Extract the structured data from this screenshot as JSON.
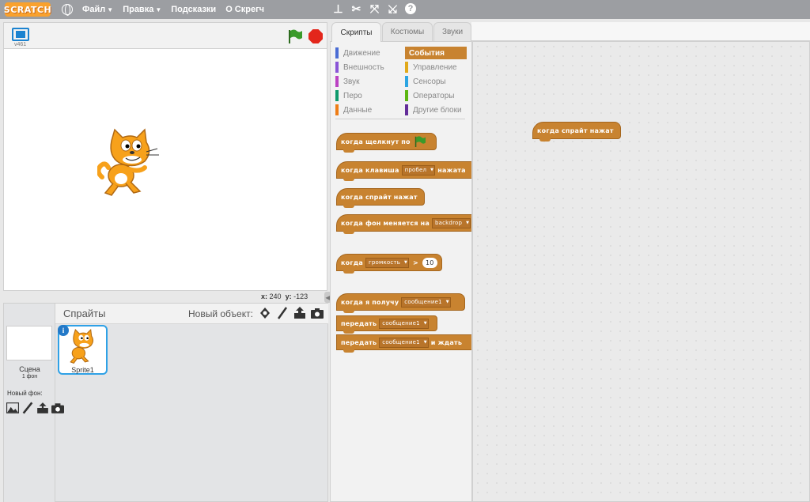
{
  "app": {
    "logo_text": "SCRATCH",
    "version": "v461"
  },
  "menu": {
    "items": [
      {
        "label": "Файл",
        "dropdown": true
      },
      {
        "label": "Правка",
        "dropdown": true
      },
      {
        "label": "Подсказки",
        "dropdown": false
      },
      {
        "label": "О Скрегч",
        "dropdown": false
      }
    ]
  },
  "stage": {
    "coords": {
      "x_label": "x:",
      "x_value": "240",
      "y_label": "y:",
      "y_value": "-123"
    }
  },
  "sprites": {
    "title": "Спрайты",
    "new_object_label": "Новый объект:",
    "stage_label": "Сцена",
    "stage_sub": "1 фон",
    "new_backdrop_label": "Новый фон:",
    "sprite_name": "Sprite1",
    "info_glyph": "i"
  },
  "tabs": [
    {
      "label": "Скрипты",
      "active": true
    },
    {
      "label": "Костюмы",
      "active": false
    },
    {
      "label": "Звуки",
      "active": false
    }
  ],
  "categories": {
    "left": [
      {
        "label": "Движение",
        "color": "#4a6cd4"
      },
      {
        "label": "Внешность",
        "color": "#8a55d7"
      },
      {
        "label": "Звук",
        "color": "#bb42c3"
      },
      {
        "label": "Перо",
        "color": "#0e9a6c"
      },
      {
        "label": "Данные",
        "color": "#ee7d16"
      }
    ],
    "right": [
      {
        "label": "События",
        "color": "#c88330",
        "selected": true
      },
      {
        "label": "Управление",
        "color": "#e1a91a"
      },
      {
        "label": "Сенсоры",
        "color": "#2ca5e2"
      },
      {
        "label": "Операторы",
        "color": "#5cb712"
      },
      {
        "label": "Другие блоки",
        "color": "#632d99"
      }
    ]
  },
  "palette_blocks": {
    "when_flag": {
      "text": "когда щелкнут по"
    },
    "when_key": {
      "text_before": "когда клавиша",
      "dropdown": "пробел",
      "text_after": "нажата"
    },
    "when_sprite_clicked": {
      "text": "когда спрайт нажат"
    },
    "when_backdrop": {
      "text": "когда фон меняется на",
      "dropdown": "backdrop"
    },
    "when_loudness": {
      "text": "когда",
      "dropdown": "громкость",
      "op": ">",
      "value": "10"
    },
    "when_receive": {
      "text": "когда я получу",
      "dropdown": "сообщение1"
    },
    "broadcast": {
      "text": "передать",
      "dropdown": "сообщение1"
    },
    "broadcast_wait": {
      "text": "передать",
      "dropdown": "сообщение1",
      "text_after": "и ждать"
    }
  },
  "script_blocks": {
    "when_sprite_clicked": {
      "text": "когда спрайт нажат"
    }
  },
  "colors": {
    "events": "#c88330",
    "menubar": "#9c9ea2",
    "selection": "#2fa1e6",
    "flag": "#3a9a2a",
    "stop": "#e3261b"
  }
}
